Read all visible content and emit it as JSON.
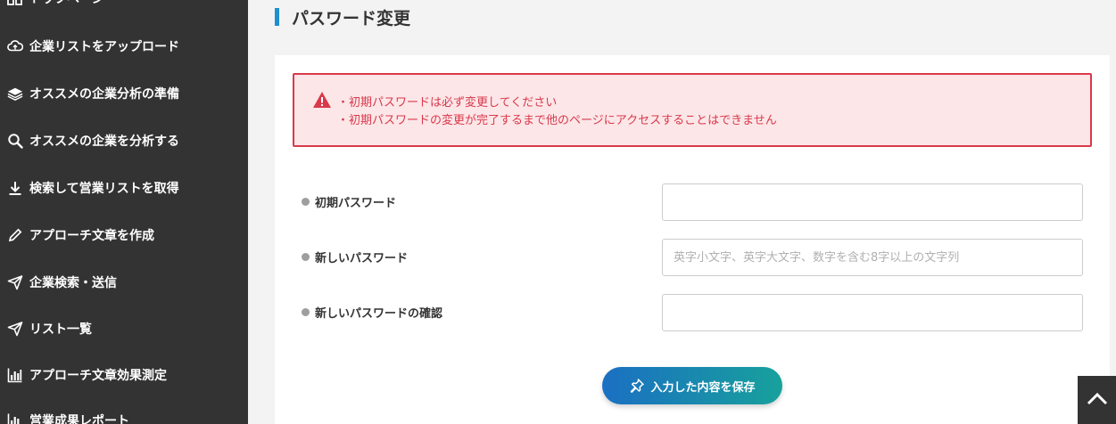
{
  "sidebar": {
    "items": [
      {
        "label": "トップページ",
        "icon": "dashboard-icon"
      },
      {
        "label": "企業リストをアップロード",
        "icon": "cloud-upload-icon"
      },
      {
        "label": "オススメの企業分析の準備",
        "icon": "layers-icon"
      },
      {
        "label": "オススメの企業を分析する",
        "icon": "search-icon"
      },
      {
        "label": "検索して営業リストを取得",
        "icon": "download-icon"
      },
      {
        "label": "アプローチ文章を作成",
        "icon": "pencil-icon"
      },
      {
        "label": "企業検索・送信",
        "icon": "send-icon"
      },
      {
        "label": "リスト一覧",
        "icon": "send-icon"
      },
      {
        "label": "アプローチ文章効果測定",
        "icon": "bar-chart-icon"
      },
      {
        "label": "営業成果レポート",
        "icon": "bar-chart-icon"
      }
    ]
  },
  "page": {
    "title": "パスワード変更"
  },
  "alert": {
    "line1": "・初期パスワードは必ず変更してください",
    "line2": "・初期パスワードの変更が完了するまで他のページにアクセスすることはできません",
    "color": "#d9394b"
  },
  "form": {
    "current_password": {
      "label": "初期パスワード",
      "value": "",
      "placeholder": ""
    },
    "new_password": {
      "label": "新しいパスワード",
      "value": "",
      "placeholder": "英字小文字、英字大文字、数字を含む8字以上の文字列"
    },
    "confirm_password": {
      "label": "新しいパスワードの確認",
      "value": "",
      "placeholder": ""
    }
  },
  "actions": {
    "save_label": "入力した内容を保存"
  },
  "colors": {
    "sidebar_bg": "#333333",
    "accent": "#1e8fd0",
    "button_gradient_start": "#1a6fc2",
    "button_gradient_end": "#18a19c"
  }
}
